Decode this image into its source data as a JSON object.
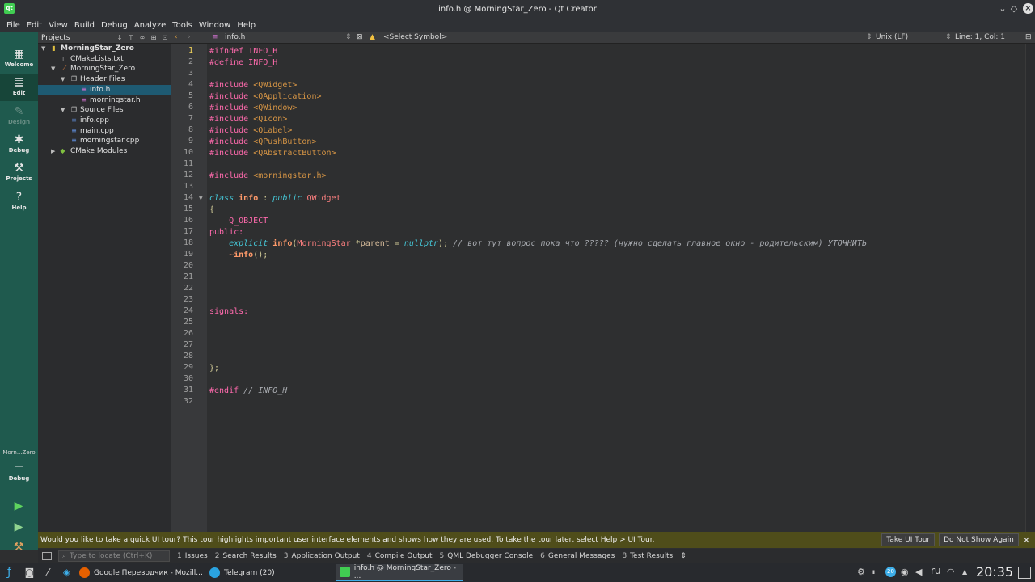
{
  "window": {
    "title": "info.h @ MorningStar_Zero - Qt Creator",
    "app_icon_text": "qt"
  },
  "menu": [
    "File",
    "Edit",
    "View",
    "Build",
    "Debug",
    "Analyze",
    "Tools",
    "Window",
    "Help"
  ],
  "modes": {
    "welcome": "Welcome",
    "edit": "Edit",
    "design": "Design",
    "debug": "Debug",
    "projects": "Projects",
    "help": "Help",
    "kit": "Morn...Zero",
    "kit_mode": "Debug"
  },
  "projects": {
    "header": "Projects",
    "tree": [
      {
        "label": "MorningStar_Zero"
      },
      {
        "label": "CMakeLists.txt"
      },
      {
        "label": "MorningStar_Zero"
      },
      {
        "label": "Header Files"
      },
      {
        "label": "info.h"
      },
      {
        "label": "morningstar.h"
      },
      {
        "label": "Source Files"
      },
      {
        "label": "info.cpp"
      },
      {
        "label": "main.cpp"
      },
      {
        "label": "morningstar.cpp"
      },
      {
        "label": "CMake Modules"
      }
    ]
  },
  "editor": {
    "file_name": "info.h",
    "symbol": "<Select Symbol>",
    "line_ending": "Unix (LF)",
    "position": "Line: 1, Col: 1",
    "current_line": 1,
    "line_numbers": [
      "1",
      "2",
      "3",
      "4",
      "5",
      "6",
      "7",
      "8",
      "9",
      "10",
      "11",
      "12",
      "13",
      "14",
      "15",
      "16",
      "17",
      "18",
      "19",
      "20",
      "21",
      "22",
      "23",
      "24",
      "25",
      "26",
      "27",
      "28",
      "29",
      "30",
      "31",
      "32"
    ],
    "code": {
      "l1_a": "#ifndef",
      "l1_b": " INFO_H",
      "l2_a": "#define",
      "l2_b": " INFO_H",
      "l4_a": "#include",
      "l4_b": " <QWidget>",
      "l5_a": "#include",
      "l5_b": " <QApplication>",
      "l6_a": "#include",
      "l6_b": " <QWindow>",
      "l7_a": "#include",
      "l7_b": " <QIcon>",
      "l8_a": "#include",
      "l8_b": " <QLabel>",
      "l9_a": "#include",
      "l9_b": " <QPushButton>",
      "l10_a": "#include",
      "l10_b": " <QAbstractButton>",
      "l12_a": "#include",
      "l12_b": " <morningstar.h>",
      "l14_a": "class",
      "l14_b": " ",
      "l14_c": "info",
      "l14_d": " : ",
      "l14_e": "public",
      "l14_f": " ",
      "l14_g": "QWidget",
      "l15": "{",
      "l16": "    Q_OBJECT",
      "l17": "public:",
      "l18_indent": "    ",
      "l18_a": "explicit",
      "l18_b": " ",
      "l18_c": "info",
      "l18_d": "(",
      "l18_e": "MorningStar",
      "l18_f": " *",
      "l18_g": "parent",
      "l18_h": " = ",
      "l18_i": "nullptr",
      "l18_j": "); ",
      "l18_cmt": "// вот тут вопрос пока что ????? (нужно сделать главное окно - родительским) УТОЧНИТЬ",
      "l19_indent": "    ",
      "l19_a": "~info",
      "l19_b": "();",
      "l24": "signals:",
      "l29": "};",
      "l31_a": "#endif",
      "l31_b": " // INFO_H"
    }
  },
  "infobar": {
    "message": "Would you like to take a quick UI tour? This tour highlights important user interface elements and shows how they are used. To take the tour later, select Help > UI Tour.",
    "take_tour": "Take UI Tour",
    "dont_show": "Do Not Show Again"
  },
  "output": {
    "locator_placeholder": "Type to locate (Ctrl+K)",
    "tabs": [
      {
        "num": "1",
        "label": "Issues"
      },
      {
        "num": "2",
        "label": "Search Results"
      },
      {
        "num": "3",
        "label": "Application Output"
      },
      {
        "num": "4",
        "label": "Compile Output"
      },
      {
        "num": "5",
        "label": "QML Debugger Console"
      },
      {
        "num": "6",
        "label": "General Messages"
      },
      {
        "num": "8",
        "label": "Test Results"
      }
    ]
  },
  "taskbar": {
    "tasks": [
      {
        "label": "Google Переводчик - Mozill..."
      },
      {
        "label": "Telegram (20)"
      },
      {
        "label": "info.h @ MorningStar_Zero - ..."
      }
    ],
    "lang": "ru",
    "badge": "20",
    "clock": "20:35"
  }
}
